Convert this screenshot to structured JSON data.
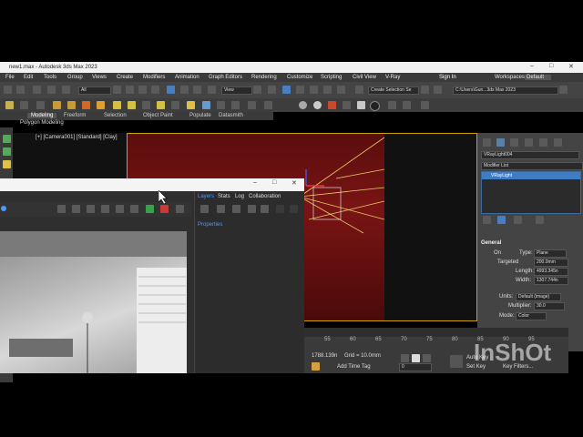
{
  "app": {
    "title": "new1.max - Autodesk 3ds Max 2023",
    "window_controls": [
      "–",
      "□",
      "✕"
    ]
  },
  "menu": [
    "File",
    "Edit",
    "Tools",
    "Group",
    "Views",
    "Create",
    "Modifiers",
    "Animation",
    "Graph Editors",
    "Rendering",
    "Customize",
    "Scripting",
    "Civil View",
    "V-Ray"
  ],
  "signin": "Sign In",
  "workspaces_label": "Workspaces:",
  "workspaces_value": "Default",
  "toolbar": {
    "filter": "All",
    "view": "View",
    "selection_set": "Create Selection Se",
    "path": "C:\\Users\\Gun...3ds Max 2023"
  },
  "ribbon": [
    "Modeling",
    "Freeform",
    "Selection",
    "Object Paint",
    "Populate",
    "Datasmith"
  ],
  "ribbon_sub": "Polygon Modeling",
  "viewport_label": "[+] [Camera001] [Standard] [Clay]",
  "command_panel": {
    "object_name": "VRayLight004",
    "modifier_list": "Modifier List",
    "stack_item": "VRayLight",
    "section": "General",
    "on_label": "On",
    "type_label": "Type:",
    "type_value": "Plane",
    "targeted_label": "Targeted",
    "targeted_value": "200.0mm",
    "length_label": "Length:",
    "length_value": "4993.345n",
    "width_label": "Width:",
    "width_value": "1307.744n",
    "units_label": "Units:",
    "units_value": "Default (image)",
    "multiplier_label": "Multiplier:",
    "multiplier_value": "30.0",
    "mode_label": "Mode:",
    "mode_value": "Color"
  },
  "timeline": {
    "ticks": [
      "55",
      "60",
      "65",
      "70",
      "75",
      "80",
      "85",
      "90",
      "95"
    ],
    "coords": "1788.139n",
    "grid": "Grid = 10.0mm",
    "add_time_tag": "Add Time Tag",
    "frame": "0",
    "auto_key": "Auto Key",
    "set_key": "Set Key",
    "key_filters": "Key Filters..."
  },
  "vfb": {
    "tabs": [
      "Layers",
      "Stats",
      "Log",
      "Collaboration"
    ],
    "properties": "Properties"
  },
  "watermark": "InShOt"
}
